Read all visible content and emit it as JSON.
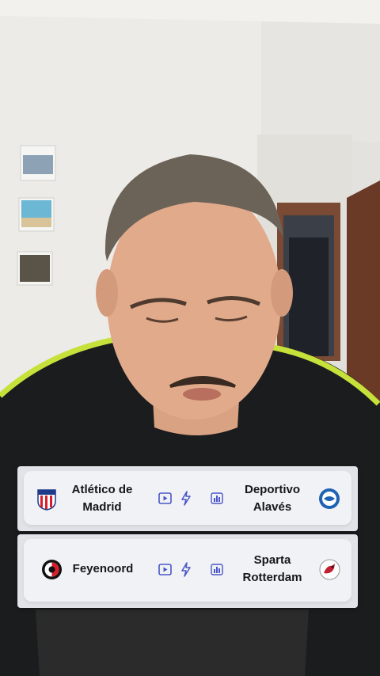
{
  "matches": [
    {
      "home": {
        "name_line1": "Atlético de",
        "name_line2": "Madrid",
        "crest_icon": "atletico-madrid-crest-icon"
      },
      "away": {
        "name_line1": "Deportivo",
        "name_line2": "Alavés",
        "crest_icon": "deportivo-alaves-crest-icon"
      },
      "action_icons": [
        "play-icon",
        "lightning-icon",
        "stats-icon"
      ]
    },
    {
      "home": {
        "name_line1": "Feyenoord",
        "crest_icon": "feyenoord-crest-icon"
      },
      "away": {
        "name_line1": "Sparta",
        "name_line2": "Rotterdam",
        "crest_icon": "sparta-rotterdam-crest-icon"
      },
      "action_icons": [
        "play-icon",
        "lightning-icon",
        "stats-icon"
      ]
    }
  ],
  "colors": {
    "icon": "#4a55c8",
    "text": "#15151c",
    "atletico_red": "#d81e2c",
    "alaves_blue": "#1e62b4",
    "jersey_neon": "#c6e23a"
  }
}
